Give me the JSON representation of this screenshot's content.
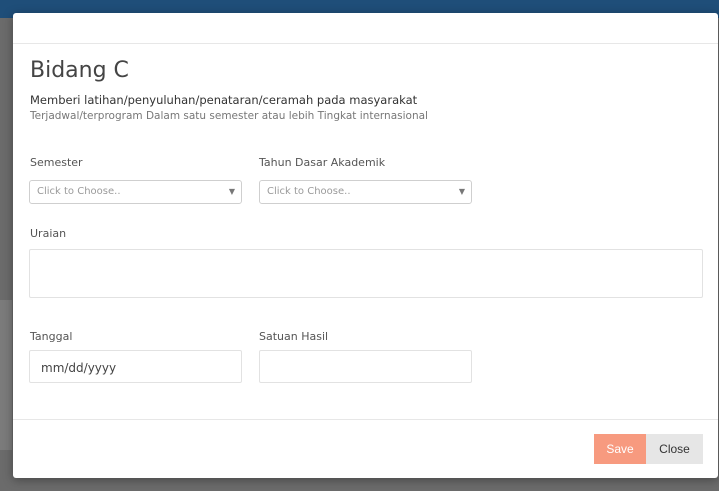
{
  "dialog": {
    "title": "Bidang C",
    "subtitle": "Memberi latihan/penyuluhan/penataran/ceramah pada masyarakat",
    "subtitle_detail": "Terjadwal/terprogram Dalam satu semester atau lebih Tingkat internasional"
  },
  "form": {
    "semester": {
      "label": "Semester",
      "placeholder": "Click to Choose.."
    },
    "tahun": {
      "label": "Tahun Dasar Akademik",
      "placeholder": "Click to Choose.."
    },
    "uraian": {
      "label": "Uraian",
      "value": ""
    },
    "tanggal": {
      "label": "Tanggal",
      "placeholder": "mm/dd/yyyy"
    },
    "satuan": {
      "label": "Satuan Hasil",
      "value": ""
    }
  },
  "footer": {
    "save_label": "Save",
    "close_label": "Close"
  },
  "colors": {
    "save_button": "#f79a7f",
    "close_button": "#e6e6e6",
    "topbar": "#1f4e79"
  }
}
